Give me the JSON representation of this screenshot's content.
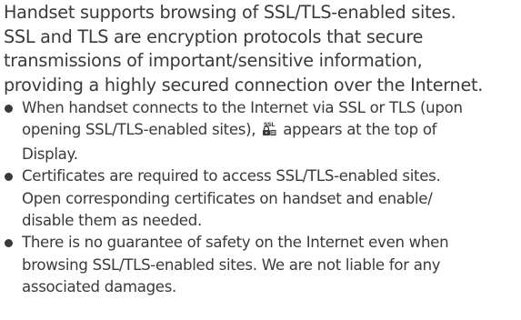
{
  "intro": {
    "lines": [
      "Handset supports browsing of SSL/TLS-enabled sites.",
      "SSL and TLS are encryption protocols that secure",
      "transmissions of important/sensitive information,",
      "providing a highly secured connection over the Internet."
    ]
  },
  "bullets": [
    {
      "line1": "When handset connects to the Internet via SSL or TLS (upon",
      "line2_before_icon": "opening SSL/TLS-enabled sites),",
      "icon": "ssl-lock-icon",
      "icon_text": "SSL",
      "line2_after_icon": "appears at the top of",
      "line3": "Display."
    },
    {
      "line1": "Certificates are required to access SSL/TLS-enabled sites.",
      "line2": "Open corresponding certificates on handset and enable/",
      "line3": "disable them as needed."
    },
    {
      "line1": "There is no guarantee of safety on the Internet even when",
      "line2": "browsing SSL/TLS-enabled sites. We are not liable for any",
      "line3": "associated damages."
    }
  ],
  "colors": {
    "text": "#3a3a3a"
  }
}
